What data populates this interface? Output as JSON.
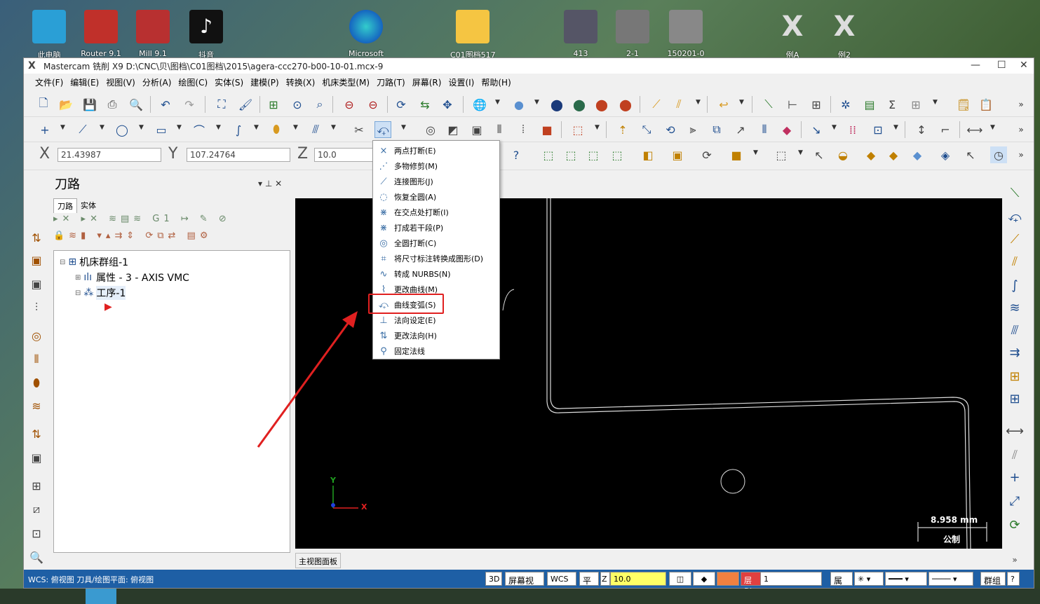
{
  "desktop": {
    "icons": [
      {
        "label": "此电脑"
      },
      {
        "label": "Router 9.1"
      },
      {
        "label": "Mill 9.1"
      },
      {
        "label": "抖音"
      },
      {
        "label": "Microsoft"
      },
      {
        "label": "C01图档517"
      },
      {
        "label": "413"
      },
      {
        "label": "2-1"
      },
      {
        "label": "150201-0"
      },
      {
        "label": "例A"
      },
      {
        "label": "例2"
      }
    ]
  },
  "window": {
    "title": "Mastercam 铣削 X9  D:\\CNC\\贝\\图档\\C01图档\\2015\\agera-ccc270-b00-10-01.mcx-9",
    "controls": {
      "minimize": "—",
      "maximize": "☐",
      "close": "✕"
    }
  },
  "menubar": [
    "文件(F)",
    "编辑(E)",
    "视图(V)",
    "分析(A)",
    "绘图(C)",
    "实体(S)",
    "建模(P)",
    "转换(X)",
    "机床类型(M)",
    "刀路(T)",
    "屏幕(R)",
    "设置(I)",
    "帮助(H)"
  ],
  "coords": {
    "x_label": "X",
    "x_value": "21.43987",
    "y_label": "Y",
    "y_value": "107.24764",
    "z_label": "Z",
    "z_value": "10.0"
  },
  "panel": {
    "title": "刀路",
    "pin": "▾ ⊥ ✕",
    "tabs": [
      "刀路",
      "实体"
    ],
    "tree": {
      "root": "机床群组-1",
      "props": "属性 - 3 - AXIS VMC",
      "op": "工序-1"
    }
  },
  "context_menu": {
    "items": [
      {
        "label": "两点打断(E)",
        "icon": "×"
      },
      {
        "label": "多物修剪(M)",
        "icon": "⋰"
      },
      {
        "label": "连接图形(J)",
        "icon": "⟋"
      },
      {
        "label": "恢复全圆(A)",
        "icon": "◌"
      },
      {
        "label": "在交点处打断(I)",
        "icon": "⋇"
      },
      {
        "label": "打成若干段(P)",
        "icon": "⋇"
      },
      {
        "label": "全圆打断(C)",
        "icon": "◎"
      },
      {
        "label": "将尺寸标注转换成图形(D)",
        "icon": "⌗"
      },
      {
        "label": "转成 NURBS(N)",
        "icon": "∿"
      },
      {
        "label": "更改曲线(M)",
        "icon": "⌇"
      },
      {
        "label": "曲线变弧(S)",
        "icon": "⤽"
      },
      {
        "label": "法向设定(E)",
        "icon": "⊥"
      },
      {
        "label": "更改法向(H)",
        "icon": "⇅"
      },
      {
        "label": "固定法线",
        "icon": "⚲"
      }
    ],
    "highlighted_index": 10
  },
  "viewport": {
    "tab": "主视图面板",
    "scale_value": "8.958 mm",
    "scale_unit": "公制",
    "axis_x": "X",
    "axis_y": "Y"
  },
  "status": {
    "left": "WCS: 俯视图  刀具/绘图平面: 俯视图",
    "btn_3d": "3D",
    "btn_screen": "屏幕视图",
    "btn_wcs": "WCS",
    "btn_plane": "平面",
    "z_label": "Z",
    "z_value": "10.0",
    "level_label": "层别",
    "level_value": "1",
    "attr_label": "属性",
    "group_label": "群组",
    "help": "?"
  },
  "colors": {
    "status_bg": "#1e5fa5",
    "highlight": "#e02020",
    "z_field": "#ffff66"
  }
}
